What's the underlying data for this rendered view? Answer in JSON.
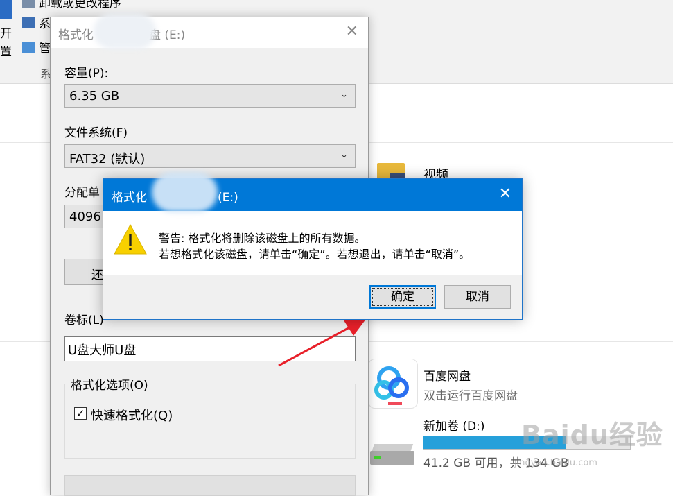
{
  "background": {
    "ribbon_left_texts": [
      "开",
      "置"
    ],
    "ribbon_items": [
      "卸载或更改程序",
      "系统属性",
      "管理"
    ],
    "ribbon_group": "系统",
    "items": {
      "video_folder": "视频",
      "baidu_name": "百度网盘",
      "baidu_sub": "双击运行百度网盘",
      "drive_name": "新加卷 (D:)",
      "drive_free": "41.2 GB 可用，共 134 GB",
      "drive_used_fraction": 0.69
    }
  },
  "format_dialog": {
    "title": "格式化 盘 (E:)",
    "title_visible_left": "格式化",
    "title_visible_right": "盘 (E:)",
    "capacity_label": "容量(P):",
    "capacity_value": "6.35 GB",
    "fs_label": "文件系统(F)",
    "fs_value": "FAT32 (默认)",
    "alloc_label": "分配单",
    "alloc_value": "4096",
    "restore_button": "还",
    "volume_label": "卷标(L)",
    "volume_value": "U盘大师U盘",
    "options_group": "格式化选项(O)",
    "quick_format": "快速格式化(Q)",
    "close": "✕"
  },
  "warning_dialog": {
    "title_left": "格式化",
    "title_right": "(E:)",
    "line1": "警告: 格式化将删除该磁盘上的所有数据。",
    "line2": "若想格式化该磁盘，请单击“确定”。若想退出，请单击“取消”。",
    "ok": "确定",
    "cancel": "取消",
    "close": "✕"
  },
  "watermark": {
    "brand": "Baidu经验",
    "url": "jingyan.baidu.com"
  },
  "colors": {
    "title_blue": "#0078d7",
    "arrow_red": "#e8202a",
    "warning_yellow": "#f8d000",
    "drive_bar": "#26a0da"
  }
}
